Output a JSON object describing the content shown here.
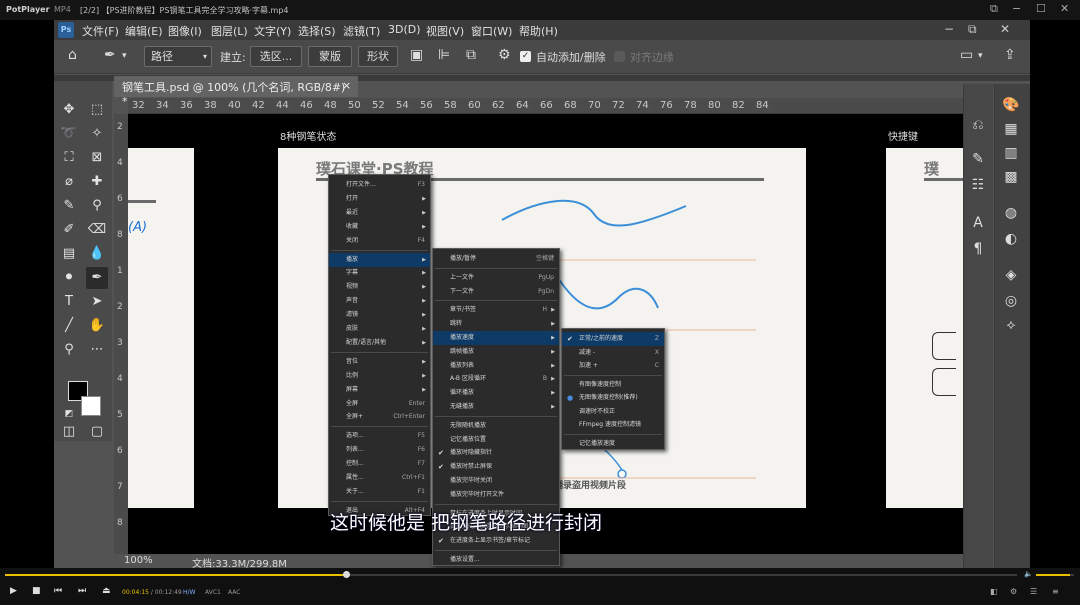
{
  "player": {
    "app_name": "PotPlayer",
    "badge": "MP4",
    "title": "[2/2]  【PS进阶教程】PS钢笔工具完全学习攻略·字幕.mp4",
    "window_controls": [
      "⧉",
      "−",
      "☐",
      "✕"
    ],
    "current_time": "00:04:15",
    "total_time": "00:12:49",
    "codec_badges": [
      "H/W",
      "AVC1",
      "AAC"
    ],
    "progress": 0.337,
    "volume": 0.9
  },
  "ps": {
    "logo": "Ps",
    "menu": [
      "文件(F)",
      "编辑(E)",
      "图像(I)",
      "图层(L)",
      "文字(Y)",
      "选择(S)",
      "滤镜(T)",
      "3D(D)",
      "视图(V)",
      "窗口(W)",
      "帮助(H)"
    ],
    "window_controls": [
      "−",
      "⧉",
      "✕"
    ],
    "options": {
      "mode": "路径",
      "make_label": "建立:",
      "selection_btn": "选区...",
      "mask_btn": "蒙版",
      "shape_btn": "形状",
      "auto_add": "自动添加/删除",
      "align_edges": "对齐边缘"
    },
    "doc_tab": "钢笔工具.psd @ 100% (几个名词, RGB/8#) *",
    "doc_tab_close": "×",
    "ruler_top": [
      "32",
      "34",
      "36",
      "38",
      "40",
      "42",
      "44",
      "46",
      "48",
      "50",
      "52",
      "54",
      "56",
      "58",
      "60",
      "62",
      "64",
      "66",
      "68",
      "70",
      "72",
      "74",
      "76",
      "78",
      "80",
      "82",
      "84"
    ],
    "ruler_left": [
      "2",
      "4",
      "6",
      "8",
      "1",
      "2",
      "3",
      "4",
      "5",
      "6",
      "7",
      "8"
    ],
    "zoom": "100%",
    "doc_info": "文档:33.3M/299.8M",
    "canvas_labels": {
      "left_page": "8种钢笔状态",
      "right_page": "快捷键",
      "brand": "璞石课堂·PS教程",
      "brand_right": "璞",
      "left_partial": "(A)",
      "watermark": "翻录盗用视频片段"
    }
  },
  "menus": {
    "main": [
      {
        "label": "打开文件...",
        "shortcut": "F3"
      },
      {
        "label": "打开",
        "arrow": true
      },
      {
        "label": "最近",
        "arrow": true
      },
      {
        "label": "收藏",
        "arrow": true
      },
      {
        "label": "关闭",
        "shortcut": "F4"
      },
      {
        "label": "播放",
        "arrow": true,
        "highlight": true
      },
      {
        "label": "字幕",
        "arrow": true
      },
      {
        "label": "视频",
        "arrow": true
      },
      {
        "label": "声音",
        "arrow": true
      },
      {
        "label": "滤镜",
        "arrow": true
      },
      {
        "label": "皮肤",
        "arrow": true
      },
      {
        "label": "配置/语言/其他",
        "arrow": true
      },
      {
        "label": "音位",
        "arrow": true
      },
      {
        "label": "比例",
        "arrow": true
      },
      {
        "label": "屏幕",
        "arrow": true
      },
      {
        "label": "全屏",
        "shortcut": "Enter"
      },
      {
        "label": "全屏+",
        "shortcut": "Ctrl+Enter"
      },
      {
        "label": "选项...",
        "shortcut": "F5"
      },
      {
        "label": "列表...",
        "shortcut": "F6"
      },
      {
        "label": "控制...",
        "shortcut": "F7"
      },
      {
        "label": "属性...",
        "shortcut": "Ctrl+F1"
      },
      {
        "label": "关于...",
        "shortcut": "F1"
      },
      {
        "label": "退出",
        "shortcut": "Alt+F4"
      }
    ],
    "play": [
      {
        "label": "播放/暂停",
        "shortcut": "空格键"
      },
      {
        "label": "上一文件",
        "shortcut": "PgUp"
      },
      {
        "label": "下一文件",
        "shortcut": "PgDn"
      },
      {
        "label": "章节/书签",
        "shortcut": "H",
        "arrow": true
      },
      {
        "label": "跳转",
        "arrow": true
      },
      {
        "label": "播放速度",
        "arrow": true,
        "highlight": true
      },
      {
        "label": "跳帧播放",
        "arrow": true
      },
      {
        "label": "播放列表",
        "arrow": true
      },
      {
        "label": "A-B 区段循环",
        "shortcut": "B",
        "arrow": true
      },
      {
        "label": "循环播放",
        "arrow": true
      },
      {
        "label": "无缝播放",
        "arrow": true
      },
      {
        "label": "无限随机播放"
      },
      {
        "label": "记忆播放位置"
      },
      {
        "label": "播放时隐藏指针",
        "check": true
      },
      {
        "label": "播放时禁止屏保",
        "check": true
      },
      {
        "label": "播放完毕时关闭"
      },
      {
        "label": "播放完毕时打开文件"
      },
      {
        "label": "鼠标在进度条上时显示时间"
      },
      {
        "label": "鼠标指向进度条时显示缩略图"
      },
      {
        "label": "在进度条上显示书签/章节标记",
        "check": true
      },
      {
        "label": "播放设置..."
      }
    ],
    "speed": [
      {
        "label": "正常/之前的速度",
        "shortcut": "Z",
        "check": true,
        "highlight": true
      },
      {
        "label": "减速 -",
        "shortcut": "X"
      },
      {
        "label": "加速 +",
        "shortcut": "C"
      },
      {
        "label": "有图像速度控制"
      },
      {
        "label": "无图像速度控制(推荐)",
        "dot": true
      },
      {
        "label": "调速时不校正"
      },
      {
        "label": "FFmpeg 速度控制滤镜"
      },
      {
        "label": "记忆播放速度"
      }
    ]
  },
  "subtitle": "这时候他是          把钢笔路径进行封闭"
}
